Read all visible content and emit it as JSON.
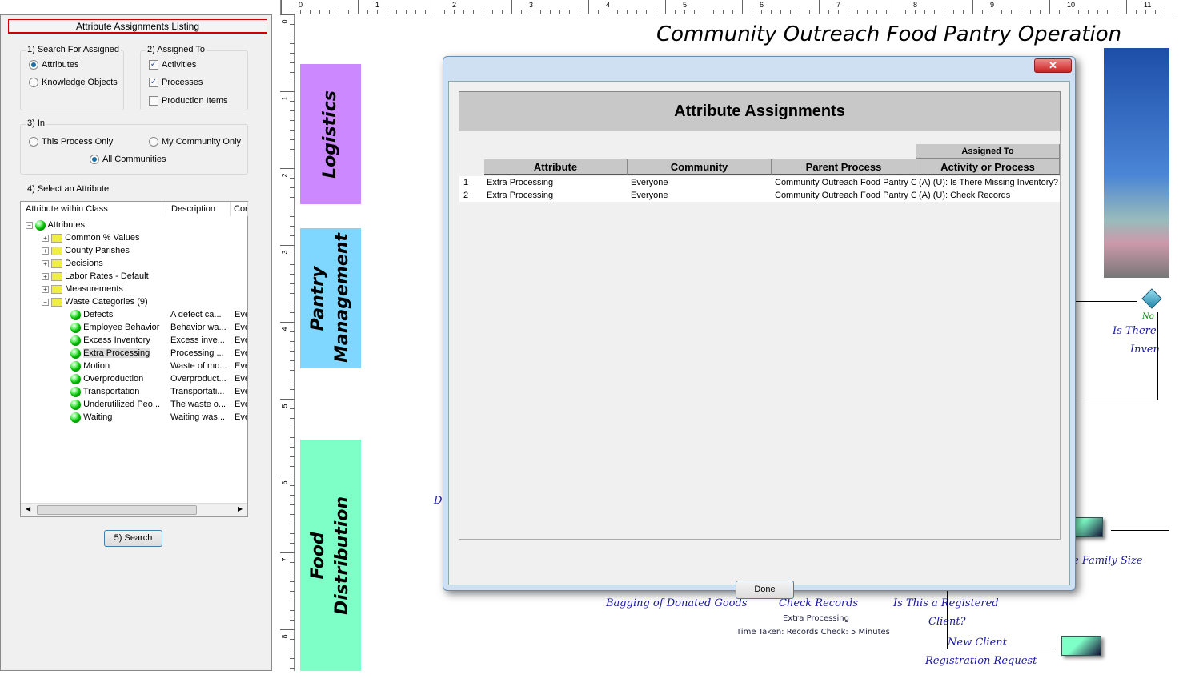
{
  "left_panel": {
    "title": "Attribute Assignments Listing",
    "search_for": {
      "label": "1) Search For Assigned",
      "options": [
        "Attributes",
        "Knowledge Objects"
      ],
      "selected": "Attributes"
    },
    "assigned_to": {
      "label": "2) Assigned To",
      "options": [
        {
          "label": "Activities",
          "checked": true
        },
        {
          "label": "Processes",
          "checked": true
        },
        {
          "label": "Production Items",
          "checked": false
        }
      ]
    },
    "in": {
      "label": "3) In",
      "options": [
        "This Process Only",
        "My Community Only",
        "All Communities"
      ],
      "selected": "All Communities"
    },
    "select_label": "4) Select an Attribute:",
    "tree": {
      "columns": [
        "Attribute within Class",
        "Description",
        "Cor"
      ],
      "root": "Attributes",
      "folders": [
        "Common % Values",
        "County Parishes",
        "Decisions",
        "Labor Rates - Default",
        "Measurements",
        "Waste Categories (9)"
      ],
      "items": [
        {
          "name": "Defects",
          "desc": "A defect ca...",
          "com": "Eve"
        },
        {
          "name": "Employee Behavior",
          "desc": "Behavior wa...",
          "com": "Eve"
        },
        {
          "name": "Excess Inventory",
          "desc": "Excess inve...",
          "com": "Eve"
        },
        {
          "name": "Extra Processing",
          "desc": "Processing ...",
          "com": "Eve",
          "selected": true
        },
        {
          "name": "Motion",
          "desc": "Waste of mo...",
          "com": "Eve"
        },
        {
          "name": "Overproduction",
          "desc": "Overproduct...",
          "com": "Eve"
        },
        {
          "name": "Transportation",
          "desc": "Transportati...",
          "com": "Eve"
        },
        {
          "name": "Underutilized Peo...",
          "desc": "The waste o...",
          "com": "Eve"
        },
        {
          "name": "Waiting",
          "desc": "Waiting was...",
          "com": "Eve"
        }
      ]
    },
    "search_button": "5) Search"
  },
  "rulers": {
    "h": [
      "0",
      "1",
      "2",
      "3",
      "4",
      "5",
      "6",
      "7",
      "8",
      "9",
      "10",
      "11"
    ],
    "v": [
      "0",
      "1",
      "2",
      "3",
      "4",
      "5",
      "6",
      "7",
      "8"
    ]
  },
  "diagram": {
    "title": "Community Outreach Food Pantry Operation",
    "lanes": [
      {
        "label": "Logistics",
        "color": "#cc88ff"
      },
      {
        "label": "Pantry Management",
        "color": "#7fd7ff"
      },
      {
        "label": "Food Distribution",
        "color": "#7fffc8"
      }
    ],
    "texts": {
      "no": "No",
      "is_there": "Is There",
      "inven": "Inven",
      "family_size": "e Family Size",
      "bagging": "Bagging of Donated Goods",
      "check_records": "Check Records",
      "extra_processing": "Extra Processing",
      "time_taken": "Time Taken: Records Check:  5 Minutes",
      "registered_1": "Is This a Registered",
      "registered_2": "Client?",
      "new_client": "New Client",
      "reg_request": "Registration Request",
      "d": "D"
    }
  },
  "dialog": {
    "close": "✕",
    "header": "Attribute Assignments",
    "group_header": "Assigned To",
    "columns": [
      "Attribute",
      "Community",
      "Parent Process",
      "Activity or Process"
    ],
    "rows": [
      {
        "n": "1",
        "attribute": "Extra Processing",
        "community": "Everyone",
        "parent": "Community Outreach Food Pantry O",
        "activity": "(A) (U):  Is There Missing Inventory?"
      },
      {
        "n": "2",
        "attribute": "Extra Processing",
        "community": "Everyone",
        "parent": "Community Outreach Food Pantry O",
        "activity": "(A) (U):  Check Records"
      }
    ],
    "done": "Done"
  }
}
